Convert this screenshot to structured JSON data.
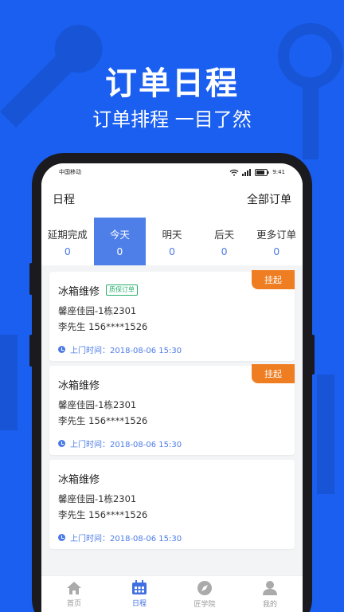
{
  "hero": {
    "title": "订单日程",
    "subtitle": "订单排程 一目了然"
  },
  "statusbar": {
    "carrier": "中国移动",
    "time": "9:41"
  },
  "header": {
    "title": "日程",
    "all_orders": "全部订单"
  },
  "tabs": [
    {
      "label": "延期完成",
      "count": "0"
    },
    {
      "label": "今天",
      "count": "0"
    },
    {
      "label": "明天",
      "count": "0"
    },
    {
      "label": "后天",
      "count": "0"
    },
    {
      "label": "更多订单",
      "count": "0"
    }
  ],
  "cards": [
    {
      "title": "冰箱维修",
      "badge": "质保订单",
      "address": "馨座佳园-1栋2301",
      "contact": "李先生  156****1526",
      "time": "上门时间：2018-08-06  15:30",
      "tag": "挂起"
    },
    {
      "title": "冰箱维修",
      "address": "馨座佳园-1栋2301",
      "contact": "李先生  156****1526",
      "time": "上门时间：2018-08-06  15:30",
      "tag": "挂起"
    },
    {
      "title": "冰箱维修",
      "address": "馨座佳园-1栋2301",
      "contact": "李先生  156****1526",
      "time": "上门时间：2018-08-06  15:30"
    }
  ],
  "nav": [
    {
      "label": "首页",
      "icon": "home-icon"
    },
    {
      "label": "日程",
      "icon": "calendar-icon"
    },
    {
      "label": "匠学院",
      "icon": "compass-icon"
    },
    {
      "label": "我的",
      "icon": "user-icon"
    }
  ],
  "colors": {
    "background": "#1a5ff0",
    "accent": "#4e7fe9",
    "tag": "#ef7e23",
    "badge": "#27b06c"
  }
}
